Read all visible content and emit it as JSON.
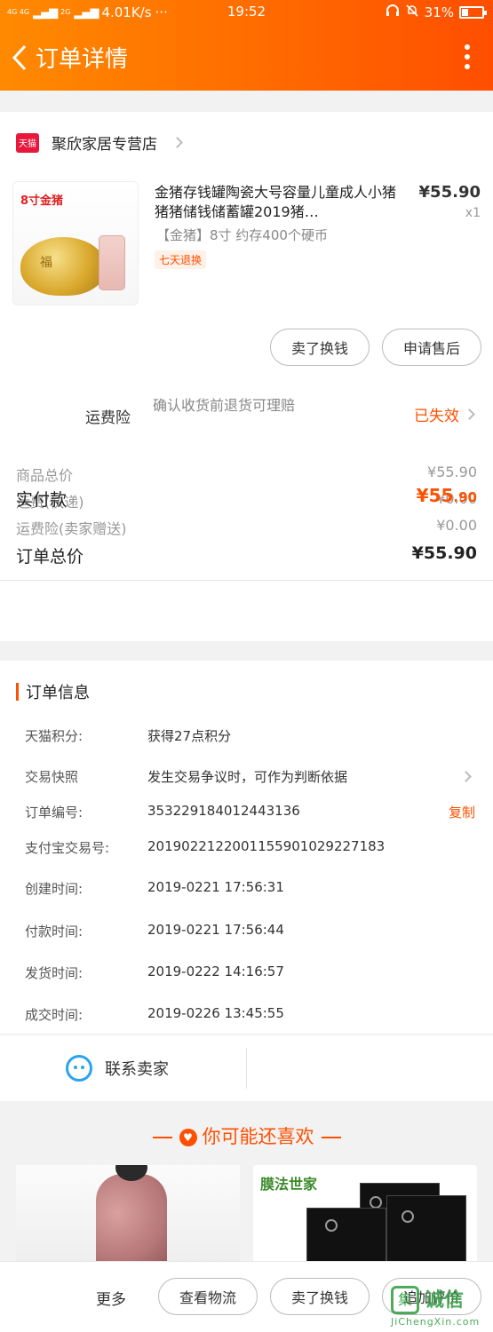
{
  "status_bar": {
    "network": "4G 4G",
    "network2": "2G",
    "signal": "▂▄▆",
    "speed": "4.01K/s",
    "dots": "···",
    "time": "19:52",
    "battery": "31%",
    "battery_level": 0.31
  },
  "nav": {
    "title": "订单详情"
  },
  "shop": {
    "badge": "天猫",
    "name": "聚欣家居专营店"
  },
  "product": {
    "title": "金猪存钱罐陶瓷大号容量儿童成人小猪猪猪储钱储蓄罐2019猪…",
    "price": "¥55.90",
    "qty": "x1",
    "spec": "【金猪】8寸 约存400个硬币",
    "tag": "七天退换",
    "thumb_label": "8寸金猪",
    "thumb_pig_text": "福"
  },
  "actions": {
    "resell": "卖了换钱",
    "after_sale": "申请售后"
  },
  "insurance": {
    "label": "运费险",
    "desc": "确认收货前退货可理赔",
    "status": "已失效"
  },
  "summary": {
    "goods_label": "商品总价",
    "goods_value": "¥55.90",
    "shipping_label": "运费(快递)",
    "shipping_value": "¥0.00",
    "ins_label": "运费险(卖家赠送)",
    "ins_value": "¥0.00",
    "total_label": "订单总价",
    "total_value": "¥55.90",
    "paid_label": "实付款",
    "paid_currency": "¥",
    "paid_int": "55",
    "paid_dec": ".90"
  },
  "order_info": {
    "title": "订单信息",
    "rows": [
      {
        "key": "天猫积分:",
        "value": "获得27点积分"
      },
      {
        "key": "交易快照",
        "value": "发生交易争议时，可作为判断依据"
      },
      {
        "key": "订单编号:",
        "value": "353229184012443136",
        "action": "复制"
      },
      {
        "key": "支付宝交易号:",
        "value": "2019022122001155901029227183"
      },
      {
        "key": "创建时间:",
        "value": "2019-0221 17:56:31"
      },
      {
        "key": "付款时间:",
        "value": "2019-0221 17:56:44"
      },
      {
        "key": "发货时间:",
        "value": "2019-0222 14:16:57"
      },
      {
        "key": "成交时间:",
        "value": "2019-0226 13:45:55"
      }
    ]
  },
  "contact": {
    "label": "联系卖家"
  },
  "recommend": {
    "title": "你可能还喜欢",
    "brand": "膜法世家"
  },
  "bottom": {
    "more": "更多",
    "logistics": "查看物流",
    "resell": "卖了换钱",
    "review": "追加评价"
  },
  "watermark": {
    "mark": "集",
    "text": "诚信",
    "url": "JiChengXin.com"
  },
  "colors": {
    "accent": "#ff5000",
    "header_start": "#ff8a00",
    "header_end": "#ff4e00",
    "tmall": "#e9173b",
    "contact_blue": "#2aa3ee"
  }
}
